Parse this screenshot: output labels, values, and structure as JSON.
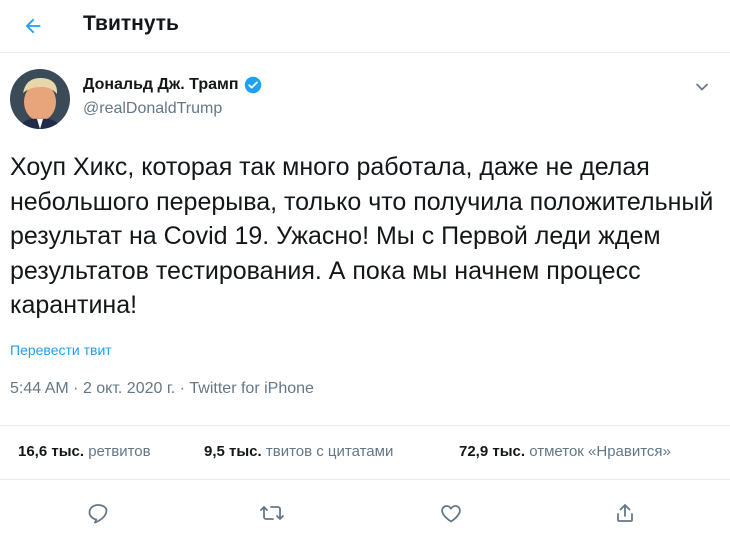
{
  "header": {
    "title": "Твитнуть",
    "back_icon": "arrow-left-icon"
  },
  "author": {
    "name": "Дональд Дж. Трамп",
    "handle": "@realDonaldTrump",
    "verified_icon": "verified-badge-icon",
    "menu_icon": "chevron-down-icon"
  },
  "tweet": {
    "text": "Хоуп Хикс, которая так много работала, даже не делая небольшого перерыва, только что получила положительный результат на Covid 19. Ужасно! Мы с Первой леди ждем результатов тестирования. А пока мы начнем процесс карантина!",
    "translate_label": "Перевести твит",
    "time": "5:44 AM",
    "separator": "·",
    "date": "2 окт. 2020 г.",
    "source": "Twitter for iPhone"
  },
  "stats": {
    "retweets": {
      "count": "16,6 тыс.",
      "label": "ретвитов"
    },
    "quotes": {
      "count": "9,5 тыс.",
      "label": "твитов с цитатами"
    },
    "likes": {
      "count": "72,9 тыс.",
      "label": "отметок «Нравится»"
    }
  },
  "actions": [
    "reply-icon",
    "retweet-icon",
    "like-icon",
    "share-icon"
  ],
  "colors": {
    "accent": "#1da1f2",
    "text": "#14171a",
    "muted": "#657786",
    "divider": "#e6ecf0"
  }
}
